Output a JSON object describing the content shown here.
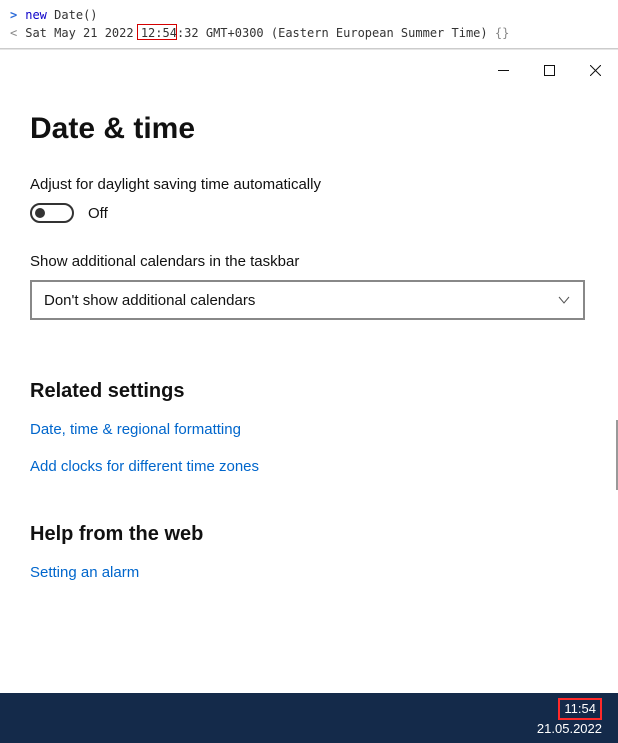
{
  "console": {
    "input_keyword": "new",
    "input_func": "Date",
    "input_parens": "()",
    "output_prefix": "Sat May 21 2022 ",
    "output_time": "12:54",
    "output_suffix": ":32 GMT+0300 (Eastern European Summer Time) ",
    "output_obj": "{}"
  },
  "settings": {
    "page_title": "Date & time",
    "dst_label": "Adjust for daylight saving time automatically",
    "dst_state": "Off",
    "calendars_label": "Show additional calendars in the taskbar",
    "calendars_value": "Don't show additional calendars",
    "related_heading": "Related settings",
    "link_regional": "Date, time & regional formatting",
    "link_clocks": "Add clocks for different time zones",
    "help_heading": "Help from the web",
    "help_alarm": "Setting an alarm"
  },
  "taskbar": {
    "time": "11:54",
    "date": "21.05.2022"
  }
}
